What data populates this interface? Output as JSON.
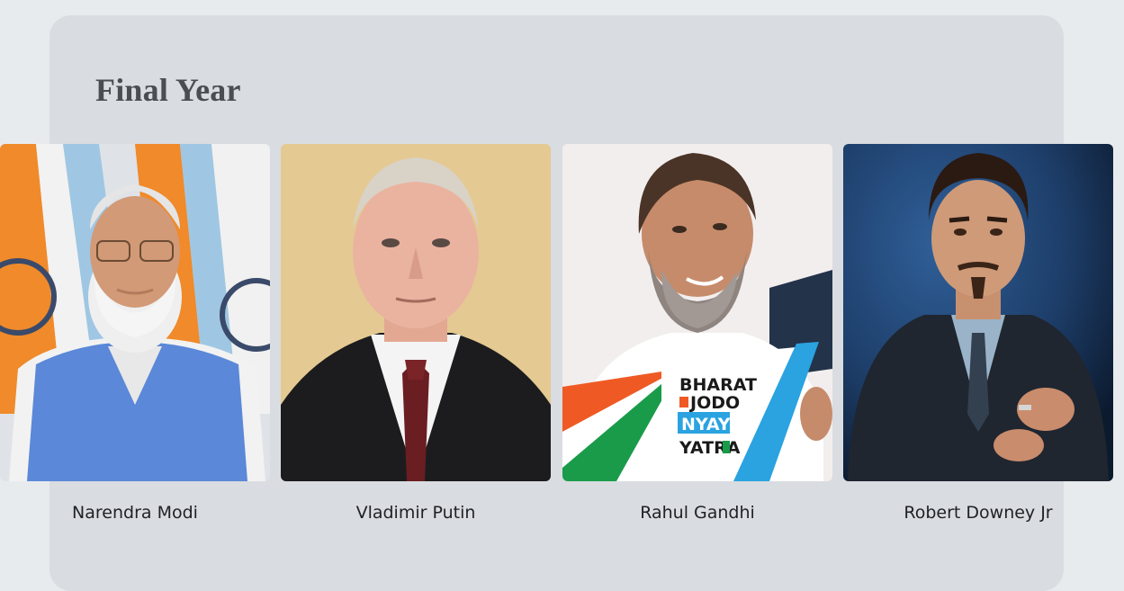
{
  "section": {
    "title": "Final Year"
  },
  "people": [
    {
      "name": "Narendra Modi",
      "photo_icon": "portrait-photo"
    },
    {
      "name": "Vladimir Putin",
      "photo_icon": "portrait-photo"
    },
    {
      "name": "Rahul Gandhi",
      "photo_icon": "portrait-photo"
    },
    {
      "name": "Robert Downey Jr",
      "photo_icon": "portrait-photo"
    }
  ],
  "banner": {
    "line1": "BHARAT",
    "line2": "JODO",
    "line3": "NYAY",
    "line4": "YATRA"
  },
  "colors": {
    "page_bg": "#e8ebee",
    "panel_bg": "#d9dce0",
    "title": "#4a4d52",
    "name_text": "#1f2124"
  }
}
